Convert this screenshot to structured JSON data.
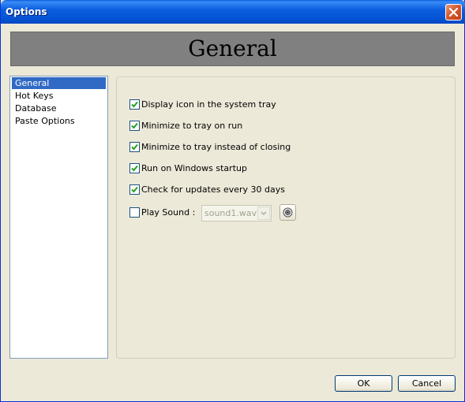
{
  "window": {
    "title": "Options"
  },
  "banner": {
    "title": "General"
  },
  "nav": {
    "items": [
      "General",
      "Hot Keys",
      "Database",
      "Paste Options"
    ],
    "selected": "General"
  },
  "options": [
    {
      "label": "Display icon in the system tray",
      "checked": true
    },
    {
      "label": "Minimize to tray on run",
      "checked": true
    },
    {
      "label": "Minimize to tray instead of closing",
      "checked": true
    },
    {
      "label": "Run on Windows startup",
      "checked": true
    },
    {
      "label": "Check for updates every 30 days",
      "checked": true
    }
  ],
  "play_sound": {
    "label": "Play Sound :",
    "checked": false,
    "sound_file": "sound1.wav",
    "disabled": true
  },
  "buttons": {
    "ok": "OK",
    "cancel": "Cancel"
  },
  "colors": {
    "titlebar": "#0453d3",
    "selection": "#316ac5",
    "dialog_bg": "#ece9d8",
    "banner": "#808080"
  }
}
